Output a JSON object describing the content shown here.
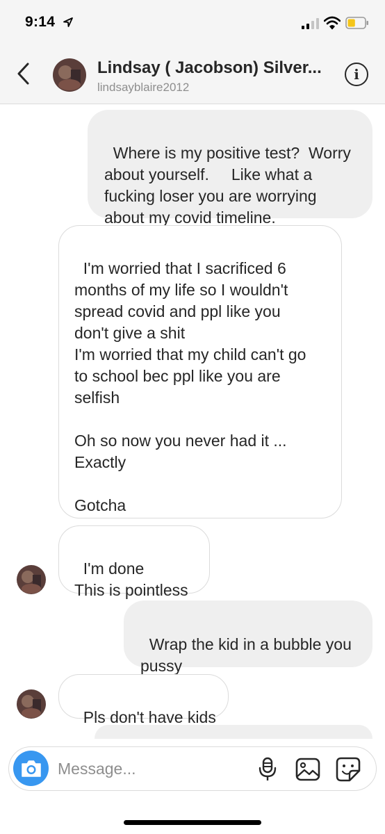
{
  "status_bar": {
    "time": "9:14",
    "icons": [
      "location-arrow-icon",
      "cellular-signal-icon",
      "wifi-icon",
      "battery-icon"
    ],
    "battery_fill": 0.45,
    "battery_color": "#f5c518"
  },
  "header": {
    "name": "Lindsay ( Jacobson) Silver...",
    "username": "lindsayblaire2012",
    "info_label": "i"
  },
  "messages": [
    {
      "direction": "sent",
      "text": "Where is my positive test?  Worry\nabout yourself.     Like what a\nfucking loser you are worrying\nabout my covid timeline."
    },
    {
      "direction": "received",
      "text": "I'm worried that I sacrificed 6\nmonths of my life so I wouldn't\nspread covid and ppl like you\ndon't give a shit\nI'm worried that my child can't go\nto school bec ppl like you are\nselfish\n\nOh so now you never had it ...\nExactly\n\nGotcha"
    },
    {
      "direction": "received",
      "text": "I'm done\nThis is pointless"
    },
    {
      "direction": "sent",
      "text": "Wrap the kid in a bubble you\npussy"
    },
    {
      "direction": "received",
      "text": "Pls don't have kids"
    }
  ],
  "composer": {
    "placeholder": "Message..."
  },
  "colors": {
    "accent": "#3897f0",
    "sent_bubble": "#efefef",
    "received_border": "#dbdbdb",
    "header_bg": "#f5f5f5"
  }
}
